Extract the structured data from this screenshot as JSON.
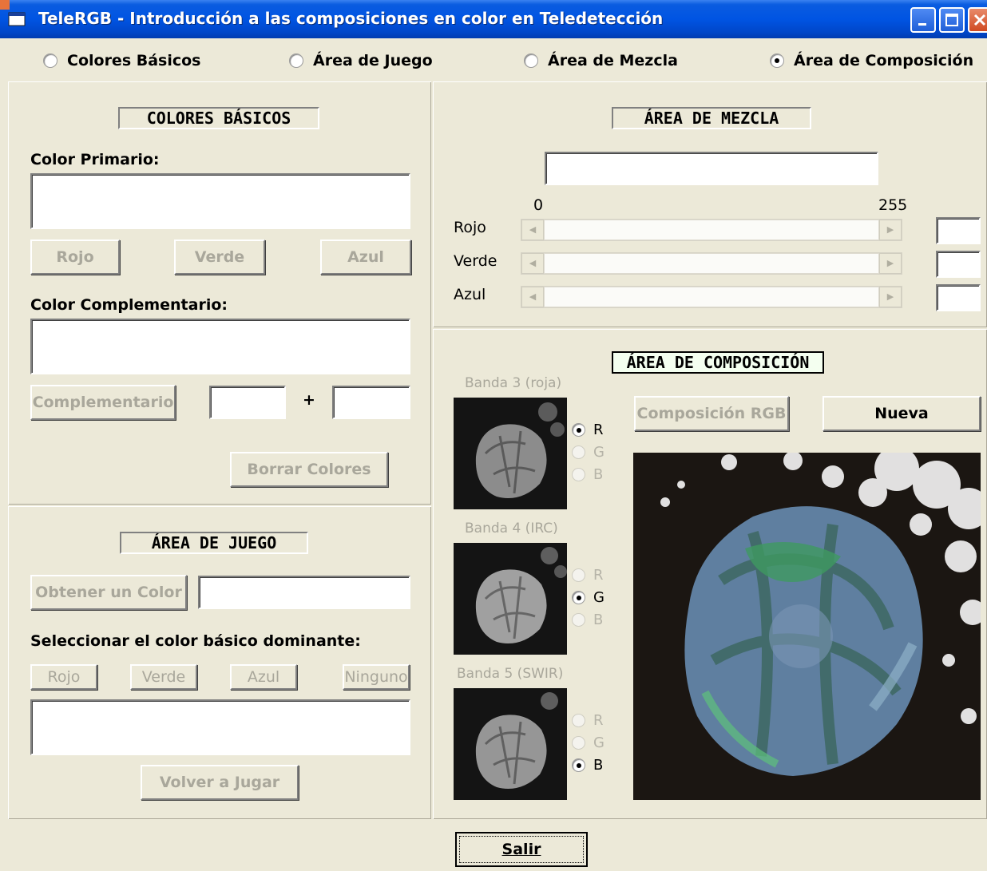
{
  "window": {
    "title": "TeleRGB - Introducción a las composiciones en color en Teledetección"
  },
  "modes": [
    {
      "label": "Colores Básicos",
      "selected": false
    },
    {
      "label": "Área de Juego",
      "selected": false
    },
    {
      "label": "Área de Mezcla",
      "selected": false
    },
    {
      "label": "Área de Composición",
      "selected": true
    }
  ],
  "basic": {
    "title": "COLORES BÁSICOS",
    "primary_label": "Color Primario:",
    "btn_red": "Rojo",
    "btn_green": "Verde",
    "btn_blue": "Azul",
    "complement_label": "Color Complementario:",
    "btn_complement": "Complementario",
    "plus": "+",
    "btn_clear": "Borrar Colores"
  },
  "game": {
    "title": "ÁREA DE JUEGO",
    "btn_get": "Obtener un Color",
    "select_label": "Seleccionar el color básico dominante:",
    "btn_red": "Rojo",
    "btn_green": "Verde",
    "btn_blue": "Azul",
    "btn_none": "Ninguno",
    "btn_replay": "Volver a Jugar"
  },
  "mix": {
    "title": "ÁREA DE MEZCLA",
    "scale_min": "0",
    "scale_max": "255",
    "red_label": "Rojo",
    "green_label": "Verde",
    "blue_label": "Azul"
  },
  "composition": {
    "title": "ÁREA DE COMPOSICIÓN",
    "btn_rgb": "Composición RGB",
    "btn_new": "Nueva",
    "bands": [
      {
        "label": "Banda 3 (roja)",
        "selected": "R"
      },
      {
        "label": "Banda 4 (IRC)",
        "selected": "G"
      },
      {
        "label": "Banda 5 (SWIR)",
        "selected": "B"
      }
    ],
    "channels": [
      "R",
      "G",
      "B"
    ]
  },
  "footer": {
    "btn_exit": "Salir"
  },
  "colors": {
    "titlebar": "#0054e3",
    "face": "#ece9d8",
    "disabled_text": "#a9a79b"
  }
}
